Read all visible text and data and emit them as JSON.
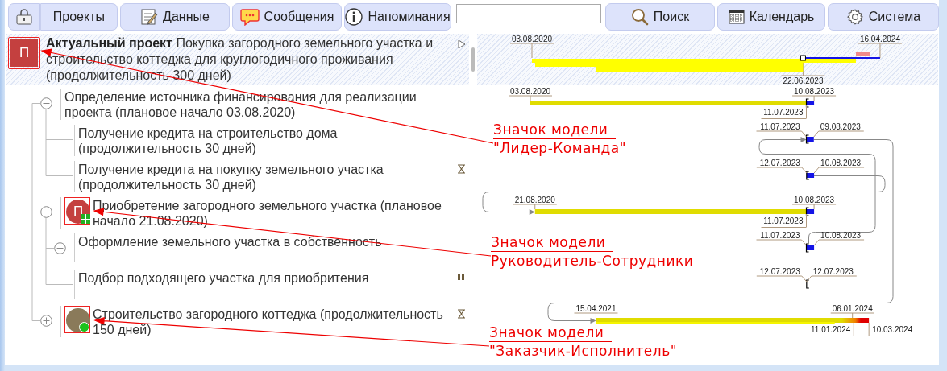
{
  "toolbar": {
    "buttons": [
      {
        "label": "Проекты"
      },
      {
        "label": "Данные"
      },
      {
        "label": "Сообщения"
      },
      {
        "label": "Напоминания"
      },
      {
        "label": "Поиск"
      },
      {
        "label": "Календарь"
      },
      {
        "label": "Система"
      }
    ]
  },
  "project": {
    "avatar": {
      "kind": "leader",
      "letter": "П"
    },
    "title": "**Актуальный проект** Покупка загородного земельного участка и строительство коттеджа для круглогодичного проживания (продолжительность 300 дней)",
    "gantt": {
      "start": "03.08.2020",
      "end": "16.04.2024",
      "today": "22.06.2023"
    }
  },
  "tasks": [
    {
      "label": "Определение источника финансирования для реализации проекта (плановое начало 03.08.2020)",
      "expanded": true,
      "gantt": {
        "kind": "progress",
        "start": "03.08.2020",
        "end": "10.08.2023",
        "today": "11.07.2023"
      },
      "children": [
        {
          "label": "Получение кредита на строительство дома (продолжительность 30 дней)",
          "gantt": {
            "kind": "short",
            "start": "11.07.2023",
            "end": "09.08.2023"
          }
        },
        {
          "label": "Получение кредита на покупку земельного участка (продолжительность 30 дней)",
          "waiting": true,
          "gantt": {
            "kind": "short",
            "start": "12.07.2023",
            "end": "10.08.2023"
          }
        }
      ]
    },
    {
      "label": "Приобретение загородного земельного участка (плановое начало 21.08.2020)",
      "expanded": true,
      "avatar": {
        "kind": "team",
        "letter": "П"
      },
      "gantt": {
        "kind": "progress",
        "start": "21.08.2020",
        "end": "10.08.2023",
        "today": "11.07.2023"
      },
      "children": [
        {
          "label": "Оформление земельного участка в собственность",
          "expanded": false,
          "gantt": {
            "kind": "short",
            "start": "11.07.2023",
            "end": "10.08.2023"
          }
        },
        {
          "label": "Подбор подходящего участка для приобритения",
          "paused": true,
          "gantt": {
            "kind": "short",
            "start": "12.07.2023",
            "end": "12.07.2023"
          }
        }
      ]
    },
    {
      "label": "Строительство загородного коттеджа (продолжительность 150 дней)",
      "expanded": false,
      "waiting": true,
      "avatar": {
        "kind": "customer"
      },
      "gantt": {
        "kind": "late",
        "start": "15.04.2021",
        "end": "06.01.2024",
        "today": "11.01.2024",
        "forecast": "10.03.2024"
      }
    }
  ],
  "callouts": [
    {
      "title": "Значок модели",
      "model": "\"Лидер-Команда\""
    },
    {
      "title": "Значок модели",
      "model": "Руководитель-Сотрудники"
    },
    {
      "title": "Значок модели",
      "model": "\"Заказчик-Исполнитель\""
    }
  ]
}
